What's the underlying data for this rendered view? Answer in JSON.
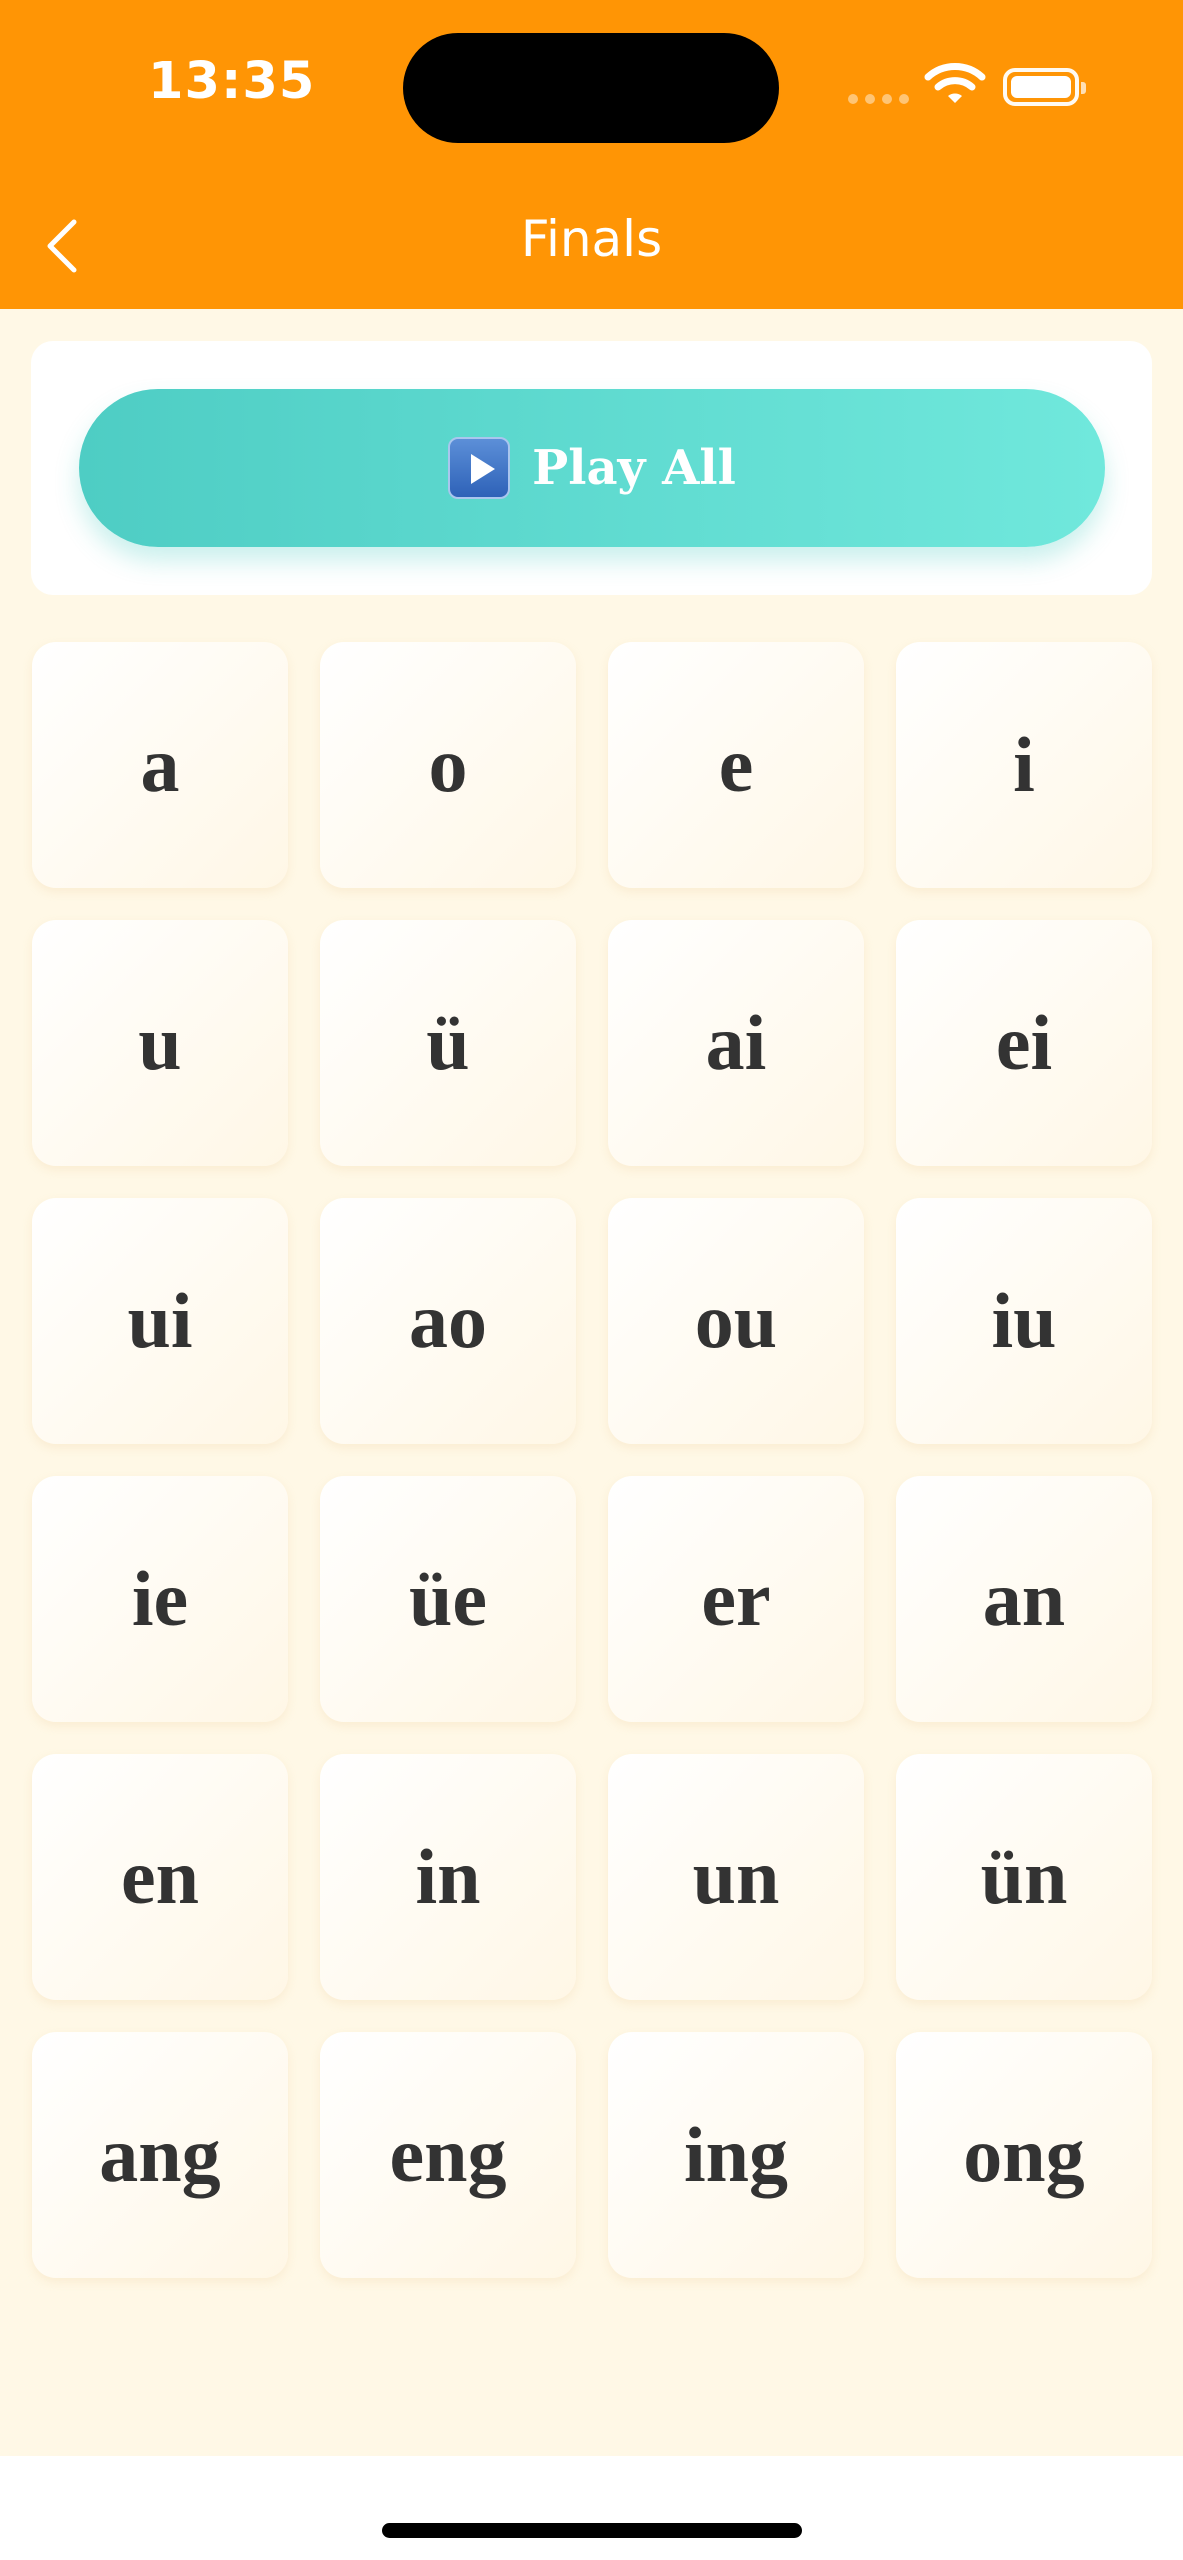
{
  "status_bar": {
    "time": "13:35"
  },
  "nav": {
    "title": "Finals"
  },
  "play_all": {
    "label": "Play All"
  },
  "finals": [
    "a",
    "o",
    "e",
    "i",
    "u",
    "ü",
    "ai",
    "ei",
    "ui",
    "ao",
    "ou",
    "iu",
    "ie",
    "üe",
    "er",
    "an",
    "en",
    "in",
    "un",
    "ün",
    "ang",
    "eng",
    "ing",
    "ong"
  ],
  "colors": {
    "header": "#FF9505",
    "background": "#FFF8E6",
    "play_button_start": "#4ECDC4",
    "play_button_end": "#70E8DC",
    "tile_text": "#333333"
  },
  "icons": {
    "back": "chevron-left-icon",
    "play": "play-icon",
    "wifi": "wifi-icon",
    "battery": "battery-icon",
    "signal": "cellular-signal-icon"
  }
}
